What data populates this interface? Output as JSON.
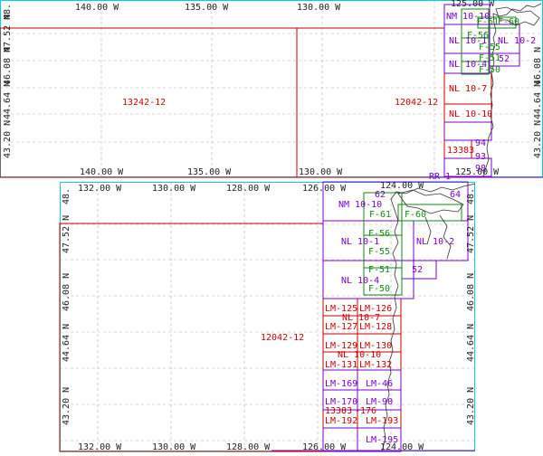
{
  "colors": {
    "frame": "#00d0e0",
    "grid": "#b0b0b0",
    "red": "#cc0000",
    "purple": "#7b00c8",
    "green": "#118a11",
    "text": "#222222"
  },
  "top_map": {
    "lon_labels": [
      "140.00 W",
      "135.00 W",
      "130.00 W",
      "125.00 W"
    ],
    "lat_labels": [
      "43.20 N",
      "44.64 N",
      "46.08 N",
      "47.52 N",
      "48."
    ],
    "chart_labels": {
      "c13242": "13242-12",
      "c12042": "12042-12",
      "nm1010": "NM 10-10",
      "f61": "F-61",
      "f56": "F-56",
      "f55": "F-55",
      "f60": "F-60",
      "nl101": "NL 10-1",
      "nl102": "NL 10-2",
      "f51": "F-51",
      "nl104": "NL 10-4",
      "n52": "52",
      "f50": "F-50",
      "nl107": "NL 10-7",
      "nl1010": "NL 10-10",
      "n94": "94",
      "n13383": "13383",
      "n93": "93",
      "n98": "98",
      "n125": "125.00 W"
    }
  },
  "bottom_map": {
    "lon_labels": [
      "132.00 W",
      "130.00 W",
      "128.00 W",
      "126.00 W",
      "124.00 W"
    ],
    "lat_labels": [
      "43.20 N",
      "44.64 N",
      "46.08 N",
      "47.52 N",
      "48."
    ],
    "chart_labels": {
      "c12042": "12042-12",
      "n62": "62",
      "n64": "64",
      "nm1010": "NM 10-10",
      "f61": "F-61",
      "f60": "F-60",
      "f56": "F-56",
      "nl101": "NL 10-1",
      "nl102": "NL 10-2",
      "f55": "F-55",
      "f51": "F-51",
      "n52": "52",
      "nl104": "NL 10-4",
      "f50": "F-50",
      "lm125": "LM-125",
      "lm126": "LM-126",
      "nl107": "NL 10-7",
      "lm127": "LM-127",
      "lm128": "LM-128",
      "lm129": "LM-129",
      "lm130": "LM-130",
      "nl1010": "NL 10-10",
      "lm131": "LM-131",
      "lm132": "LM-132",
      "lm169": "LM-169",
      "lm46": "LM-46",
      "lm170": "LM-170",
      "lm90": "LM-90",
      "n13383": "13383",
      "n176": "-176",
      "lm192": "LM-192",
      "lm193": "LM-193",
      "lm195": "LM-195",
      "rr": "RR 1"
    }
  }
}
